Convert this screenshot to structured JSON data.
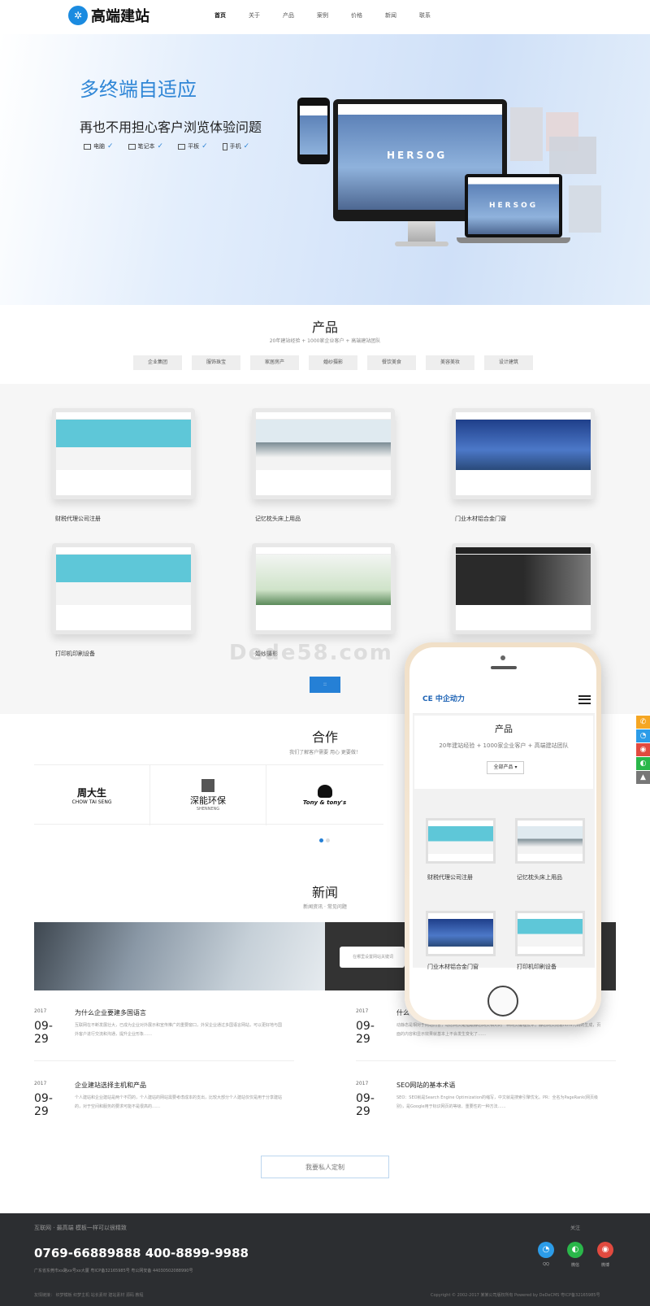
{
  "header": {
    "logo_text": "高端建站",
    "nav": [
      "首页",
      "关于",
      "产品",
      "案例",
      "价格",
      "新闻",
      "联系"
    ]
  },
  "hero": {
    "title": "多终端自适应",
    "subtitle": "再也不用担心客户浏览体验问题",
    "devices": [
      "电脑",
      "笔记本",
      "平板",
      "手机"
    ],
    "mockup_brand": "HERSOG"
  },
  "products": {
    "title": "产品",
    "subtitle": "20年建站经验 + 1000家企业客户 + 高端建站团队",
    "categories": [
      "企业集团",
      "服饰珠宝",
      "家居房产",
      "婚纱摄影",
      "餐饮美食",
      "美容美妆",
      "设计建筑"
    ],
    "items": [
      {
        "label": "财税代理公司注册"
      },
      {
        "label": "记忆枕头床上用品"
      },
      {
        "label": "门业木材铝合金门窗"
      },
      {
        "label": "打印机印刷设备"
      },
      {
        "label": "婚纱摄影"
      },
      {
        "label": ""
      }
    ],
    "more_button": "::"
  },
  "watermark": "Dede58.com",
  "partners": {
    "title": "合作",
    "subtitle": "我们了解客户需要 用心 更要做！",
    "logos": [
      {
        "name": "周大生",
        "sub": "CHOW TAI SENG"
      },
      {
        "name": "深能环保",
        "sub": "SHENNENG"
      },
      {
        "name": "Tony & tony's",
        "sub": ""
      }
    ]
  },
  "news": {
    "title": "新闻",
    "subtitle": "新闻资讯 · 常见问题",
    "search_placeholder": "在哪里设置网站关键词",
    "items": [
      {
        "year": "2017",
        "day": "09-29",
        "title": "为什么企业要建多国语言",
        "text": "互联网在不断发展壮大，已成为企业对外展示和宣传推广的重要窗口，外贸企业通过多国语言网站，可以更好地与国外客户进行交流和沟通，提升企业形象……"
      },
      {
        "year": "2017",
        "day": "09-29",
        "title": "什么",
        "text": "动静态是相对于网站而言，动态网页是指跟静态网页相对的一种网页编程技术，静态网页随着html代码的生成，页面的内容和显示效果就基本上不会发生变化了……"
      },
      {
        "year": "2017",
        "day": "09-29",
        "title": "企业建站选择主机和产品",
        "text": "个人建站和企业建站是两个不同的，个人建站的网站需要考虑成本的支出，比较大部分个人建站仅仅是用于分享建站的，对于空间和服务的要求可能不是很高的……"
      },
      {
        "year": "2017",
        "day": "09-29",
        "title": "SEO网站的基本术语",
        "text": "SEO：SEO就是Search Engine Optimization的缩写，中文就是搜索引擎优化。PR：全名为PageRank(网页级别)，是Google用于标识网页的等级、重要性的一种方法……"
      }
    ],
    "custom_button": "我要私人定制"
  },
  "phone": {
    "logo": "CE 中企动力",
    "title": "产品",
    "subtitle": "20年建站经验 + 1000家企业客户 + 高端建站团队",
    "select": "全部产品 ▾",
    "items": [
      "财税代理公司注册",
      "记忆枕头床上用品",
      "门业木材铝合金门窗",
      "打印机印刷设备"
    ]
  },
  "footer": {
    "tagline": "互联网 · 最高端 模板一样可以很精致",
    "phones": "0769-66889888 400-8899-9988",
    "address": "广东省东莞市xx路xx号xx大厦  粤ICP备32165985号  粤公网安备 44030502088990号",
    "links": "友情链接：  织梦模板  织梦主机  站长素材  建站素材  源码  教程",
    "copyright": "Copyright © 2002-2017 某某公司版权所有 Powered by DeDeCMS 粤ICP备32165985号",
    "follow": "关注",
    "socials": [
      {
        "label": "QQ",
        "color": "#2c9ce8"
      },
      {
        "label": "微信",
        "color": "#2ab74a"
      },
      {
        "label": "微博",
        "color": "#e24a3f"
      }
    ]
  },
  "colors": {
    "accent": "#2580d6",
    "footer_bg": "#2c2e31"
  }
}
